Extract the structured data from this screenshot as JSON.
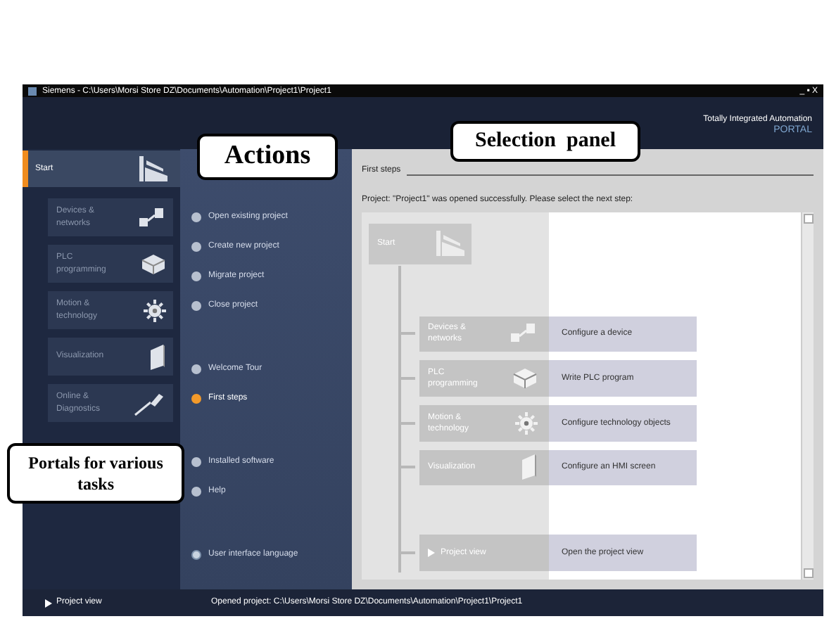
{
  "window": {
    "title": "Siemens - C:\\Users\\Morsi Store DZ\\Documents\\Automation\\Project1\\Project1",
    "controls": "_ ▪ X"
  },
  "header": {
    "line1": "Totally Integrated Automation",
    "line2": "PORTAL"
  },
  "portals": [
    {
      "label": "Start",
      "selected": true
    },
    {
      "label": "Devices & networks",
      "selected": false
    },
    {
      "label": "PLC programming",
      "selected": false
    },
    {
      "label": "Motion & technology",
      "selected": false
    },
    {
      "label": "Visualization",
      "selected": false
    },
    {
      "label": "Online & Diagnostics",
      "selected": false
    }
  ],
  "actions": [
    {
      "label": "Open existing project",
      "selected": false,
      "kind": "bullet"
    },
    {
      "label": "Create new project",
      "selected": false,
      "kind": "bullet"
    },
    {
      "label": "Migrate project",
      "selected": false,
      "kind": "bullet"
    },
    {
      "label": "Close project",
      "selected": false,
      "kind": "bullet"
    },
    {
      "label": "Welcome Tour",
      "selected": false,
      "kind": "bullet"
    },
    {
      "label": "First steps",
      "selected": true,
      "kind": "bullet"
    },
    {
      "label": "Installed software",
      "selected": false,
      "kind": "bullet"
    },
    {
      "label": "Help",
      "selected": false,
      "kind": "bullet"
    },
    {
      "label": "User interface language",
      "selected": false,
      "kind": "globe"
    }
  ],
  "panel": {
    "heading": "First steps",
    "message": "Project: \"Project1\" was opened successfully. Please select the next step:",
    "start": "Start",
    "steps": [
      {
        "portal": "Devices & networks",
        "kind": "portal",
        "action": "Configure a device"
      },
      {
        "portal": "PLC programming",
        "kind": "portal",
        "action": "Write PLC program"
      },
      {
        "portal": "Motion & technology",
        "kind": "portal",
        "action": "Configure technology objects"
      },
      {
        "portal": "Visualization",
        "kind": "portal",
        "action": "Configure an HMI screen"
      },
      {
        "portal": "Project view",
        "kind": "view",
        "action": "Open the project view"
      }
    ]
  },
  "status_bar": {
    "project_view": "Project view",
    "opened_label": "Opened project:",
    "opened_path": "C:\\Users\\Morsi Store DZ\\Documents\\Automation\\Project1\\Project1"
  },
  "callouts": [
    {
      "text": "Actions",
      "kind": "actions"
    },
    {
      "text": "Selection  panel",
      "kind": "selection"
    },
    {
      "text": "Portals for various tasks",
      "kind": "portals"
    }
  ]
}
